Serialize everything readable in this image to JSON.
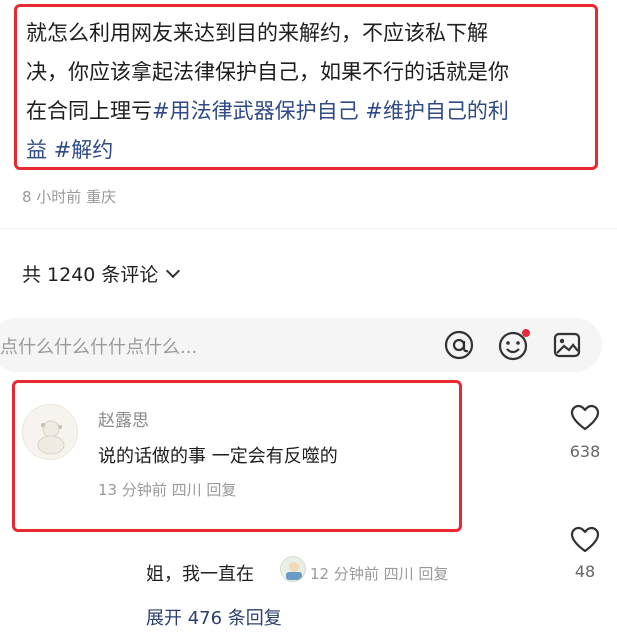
{
  "post": {
    "line1": "就怎么利用网友来达到目的来解约，不应该私下解",
    "line2": "决，你应该拿起法律保护自己，如果不行的话就是你",
    "line3_plain": "在合同上理亏",
    "tag1": "#用法律武器保护自己",
    "tag2": "#维护自己的利",
    "tag2_cont": "益",
    "tag3": "#解约",
    "meta": "8 小时前 重庆"
  },
  "comments_header": {
    "count_label": "共 1240 条评论"
  },
  "input_bar": {
    "placeholder": "点什么什么什什点什么..."
  },
  "comments": [
    {
      "author": "赵露思",
      "text": "说的话做的事 一定会有反噬的",
      "meta": "13 分钟前 四川 回复",
      "likes": "638"
    },
    {
      "text": "姐，我一直在",
      "meta": "12 分钟前 四川 回复",
      "likes": "48"
    }
  ],
  "expand_replies": "展开 476 条回复",
  "colors": {
    "highlight_border": "#e8292d",
    "hashtag": "#2f4a86",
    "expand_link": "#2a3f70",
    "notification_dot": "#e8293c"
  },
  "icons": [
    "at-icon",
    "emoji-icon",
    "image-icon",
    "heart-icon",
    "chevron-down-icon"
  ]
}
